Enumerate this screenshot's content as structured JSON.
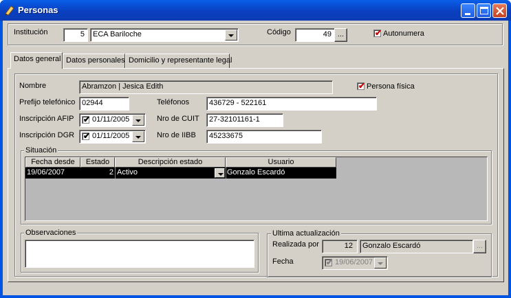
{
  "window": {
    "title": "Personas"
  },
  "header": {
    "institucion_label": "Institución",
    "institucion_id": "5",
    "institucion_name": "ECA Bariloche",
    "codigo_label": "Código",
    "codigo_value": "49",
    "codigo_button": "...",
    "autonumera_label": "Autonumera",
    "autonumera_checked": true
  },
  "tabs": [
    {
      "label": "Datos general",
      "active": true
    },
    {
      "label": "Datos personales",
      "active": false
    },
    {
      "label": "Domicilio y representante legal",
      "active": false
    }
  ],
  "general": {
    "nombre_label": "Nombre",
    "nombre_value": "Abramzon | Jesica Edith",
    "persona_fisica_label": "Persona física",
    "persona_fisica_checked": true,
    "prefijo_label": "Prefijo telefónico",
    "prefijo_value": "02944",
    "telefonos_label": "Teléfonos",
    "telefonos_value": "436729 - 522161",
    "afip_label": "Inscripción AFIP",
    "afip_value": "01/11/2005",
    "cuit_label": "Nro de CUIT",
    "cuit_value": "27-32101161-1",
    "dgr_label": "Inscripción DGR",
    "dgr_value": "01/11/2005",
    "iibb_label": "Nro de IIBB",
    "iibb_value": "45233675"
  },
  "situacion": {
    "title": "Situación",
    "columns": [
      "Fecha desde",
      "Estado",
      "Descripción estado",
      "Usuario"
    ],
    "rows": [
      {
        "fecha": "19/06/2007",
        "estado": "2",
        "descripcion": "Activo",
        "usuario": "Gonzalo Escardó"
      }
    ]
  },
  "observaciones": {
    "title": "Observaciones",
    "value": ""
  },
  "ultima": {
    "title": "Ultima actualización",
    "realizada_label": "Realizada por",
    "realizada_id": "12",
    "realizada_name": "Gonzalo Escardó",
    "realizada_button": "...",
    "fecha_label": "Fecha",
    "fecha_value": "19/06/2007"
  },
  "colors": {
    "title_bar": "#0a3fbf",
    "face": "#d4d0c8",
    "selection": "#000000",
    "check_red": "#cc0000"
  }
}
